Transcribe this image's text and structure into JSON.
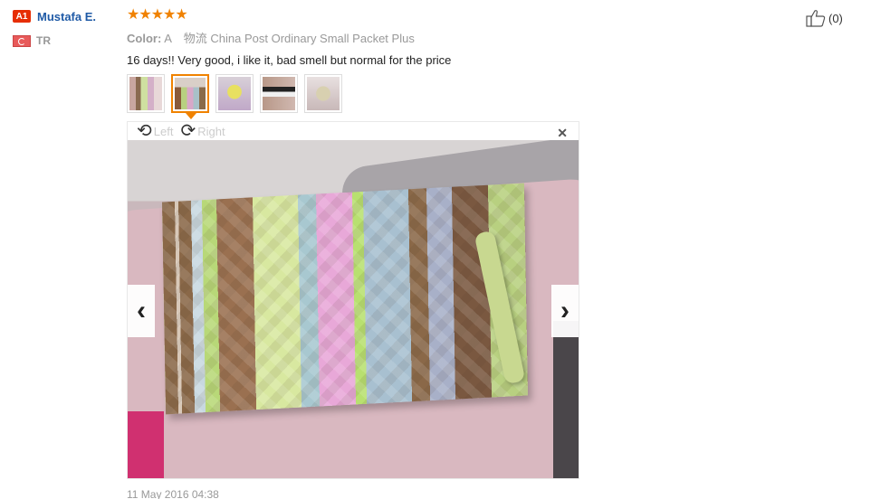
{
  "user": {
    "level_badge": "A1",
    "name": "Mustafa E.",
    "country_code": "TR"
  },
  "review": {
    "rating": 5,
    "stars": [
      "★",
      "★",
      "★",
      "★",
      "★"
    ],
    "color_label": "Color:",
    "color_value": "A",
    "shipping": "物流 China Post Ordinary Small Packet Plus",
    "text": "16 days!! Very good, i like it, bad smell but normal for the price",
    "thumbnails": [
      "photo-1",
      "photo-2",
      "photo-3",
      "photo-4",
      "photo-5"
    ],
    "active_thumbnail": 2,
    "date": "11 May 2016 04:38"
  },
  "viewer": {
    "rotate_left_label": "Left",
    "rotate_right_label": "Right",
    "close_icon": "close-icon",
    "prev_icon": "chevron-left-icon",
    "next_icon": "chevron-right-icon"
  },
  "helpful": {
    "count": "(0)"
  },
  "colors": {
    "accent": "#f08200",
    "badge": "#e62e04",
    "link": "#1f5aa6"
  }
}
